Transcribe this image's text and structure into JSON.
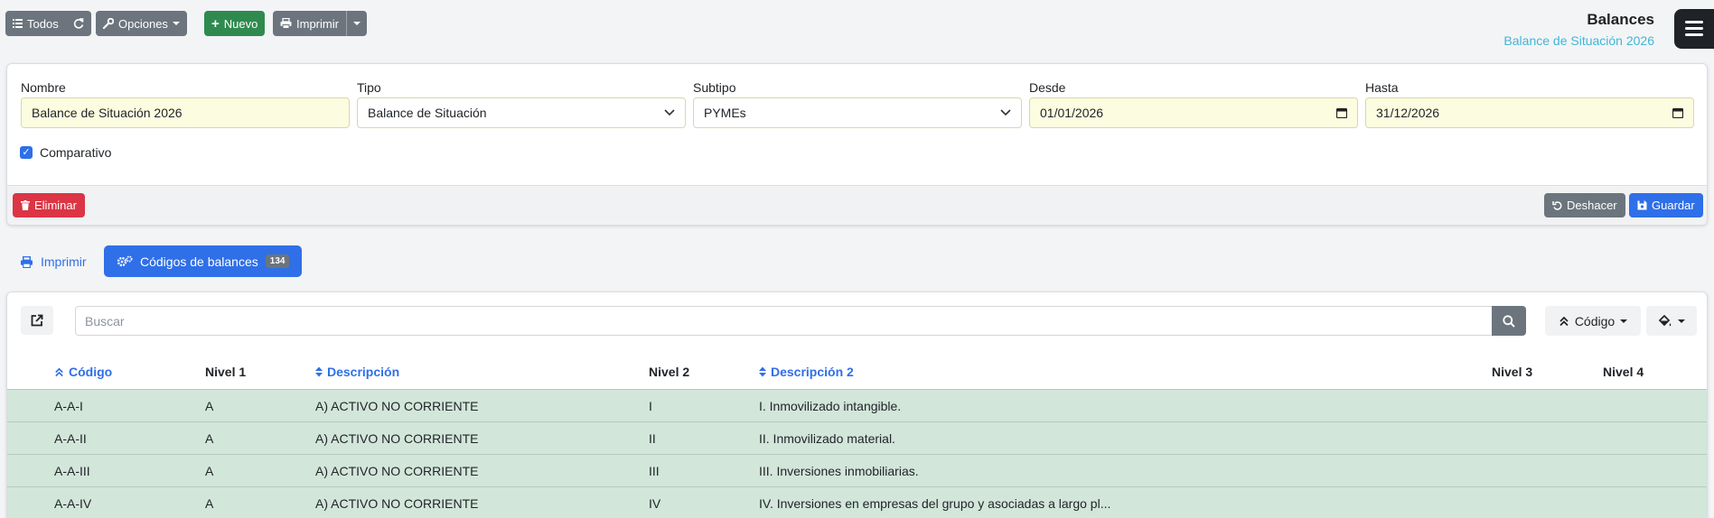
{
  "toolbar": {
    "todos_label": "Todos",
    "opciones_label": "Opciones",
    "nuevo_label": "Nuevo",
    "imprimir_label": "Imprimir"
  },
  "header": {
    "title": "Balances",
    "subtitle": "Balance de Situación 2026"
  },
  "form": {
    "nombre": {
      "label": "Nombre",
      "value": "Balance de Situación 2026"
    },
    "tipo": {
      "label": "Tipo",
      "value": "Balance de Situación"
    },
    "subtipo": {
      "label": "Subtipo",
      "value": "PYMEs"
    },
    "desde": {
      "label": "Desde",
      "value": "01/01/2026"
    },
    "hasta": {
      "label": "Hasta",
      "value": "31/12/2026"
    },
    "comparativo": {
      "label": "Comparativo",
      "checked": true
    },
    "eliminar_label": "Eliminar",
    "deshacer_label": "Deshacer",
    "guardar_label": "Guardar"
  },
  "tabs": {
    "print_label": "Imprimir",
    "codes_label": "Códigos de balances",
    "codes_count": "134"
  },
  "list": {
    "search_placeholder": "Buscar",
    "sort_label": "Código",
    "columns": [
      "Código",
      "Nivel 1",
      "Descripción",
      "Nivel 2",
      "Descripción 2",
      "Nivel 3",
      "Nivel 4"
    ],
    "rows": [
      {
        "codigo": "A-A-I",
        "nivel1": "A",
        "descripcion": "A) ACTIVO NO CORRIENTE",
        "nivel2": "I",
        "descripcion2": "I. Inmovilizado intangible.",
        "nivel3": "",
        "nivel4": ""
      },
      {
        "codigo": "A-A-II",
        "nivel1": "A",
        "descripcion": "A) ACTIVO NO CORRIENTE",
        "nivel2": "II",
        "descripcion2": "II. Inmovilizado material.",
        "nivel3": "",
        "nivel4": ""
      },
      {
        "codigo": "A-A-III",
        "nivel1": "A",
        "descripcion": "A) ACTIVO NO CORRIENTE",
        "nivel2": "III",
        "descripcion2": "III. Inversiones inmobiliarias.",
        "nivel3": "",
        "nivel4": ""
      },
      {
        "codigo": "A-A-IV",
        "nivel1": "A",
        "descripcion": "A) ACTIVO NO CORRIENTE",
        "nivel2": "IV",
        "descripcion2": "IV. Inversiones en empresas del grupo y asociadas a largo pl...",
        "nivel3": "",
        "nivel4": ""
      }
    ]
  },
  "colors": {
    "primary": "#2f6fe8",
    "success": "#2f8a4f",
    "danger": "#dc3545",
    "secondary": "#6c757d",
    "row_bg": "#d2e6da",
    "input_bg": "#fcfce0",
    "subtitle": "#3fb6d8"
  }
}
